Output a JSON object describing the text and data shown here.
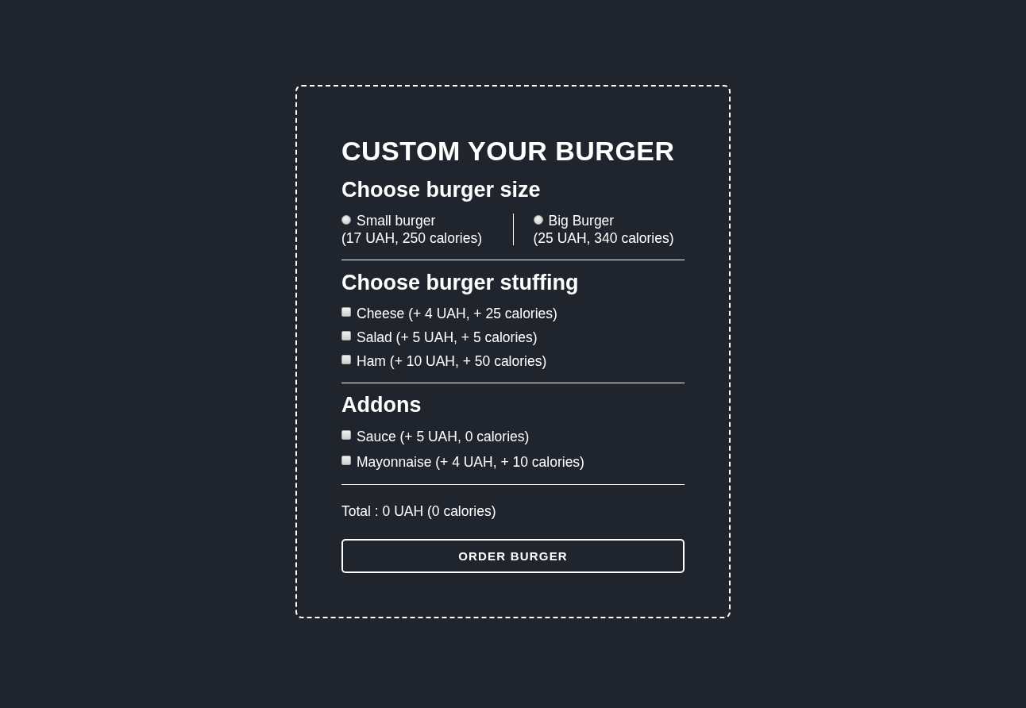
{
  "title": "CUSTOM YOUR BURGER",
  "size_section": {
    "heading": "Choose burger size",
    "options": [
      {
        "name": "Small burger",
        "detail": "(17 UAH, 250 calories)",
        "selected": false
      },
      {
        "name": "Big Burger",
        "detail": "(25 UAH, 340 calories)",
        "selected": false
      }
    ]
  },
  "stuffing_section": {
    "heading": "Choose burger stuffing",
    "items": [
      {
        "label": "Cheese (+ 4 UAH, + 25 calories)",
        "checked": false
      },
      {
        "label": "Salad (+ 5 UAH, + 5 calories)",
        "checked": false
      },
      {
        "label": "Ham (+ 10 UAH, + 50 calories)",
        "checked": false
      }
    ]
  },
  "addons_section": {
    "heading": "Addons",
    "items": [
      {
        "label": "Sauce (+ 5 UAH, 0 calories)",
        "checked": false
      },
      {
        "label": "Mayonnaise (+ 4 UAH, + 10 calories)",
        "checked": false
      }
    ]
  },
  "total": "Total : 0 UAH (0 calories)",
  "order_button": "ORDER BURGER"
}
